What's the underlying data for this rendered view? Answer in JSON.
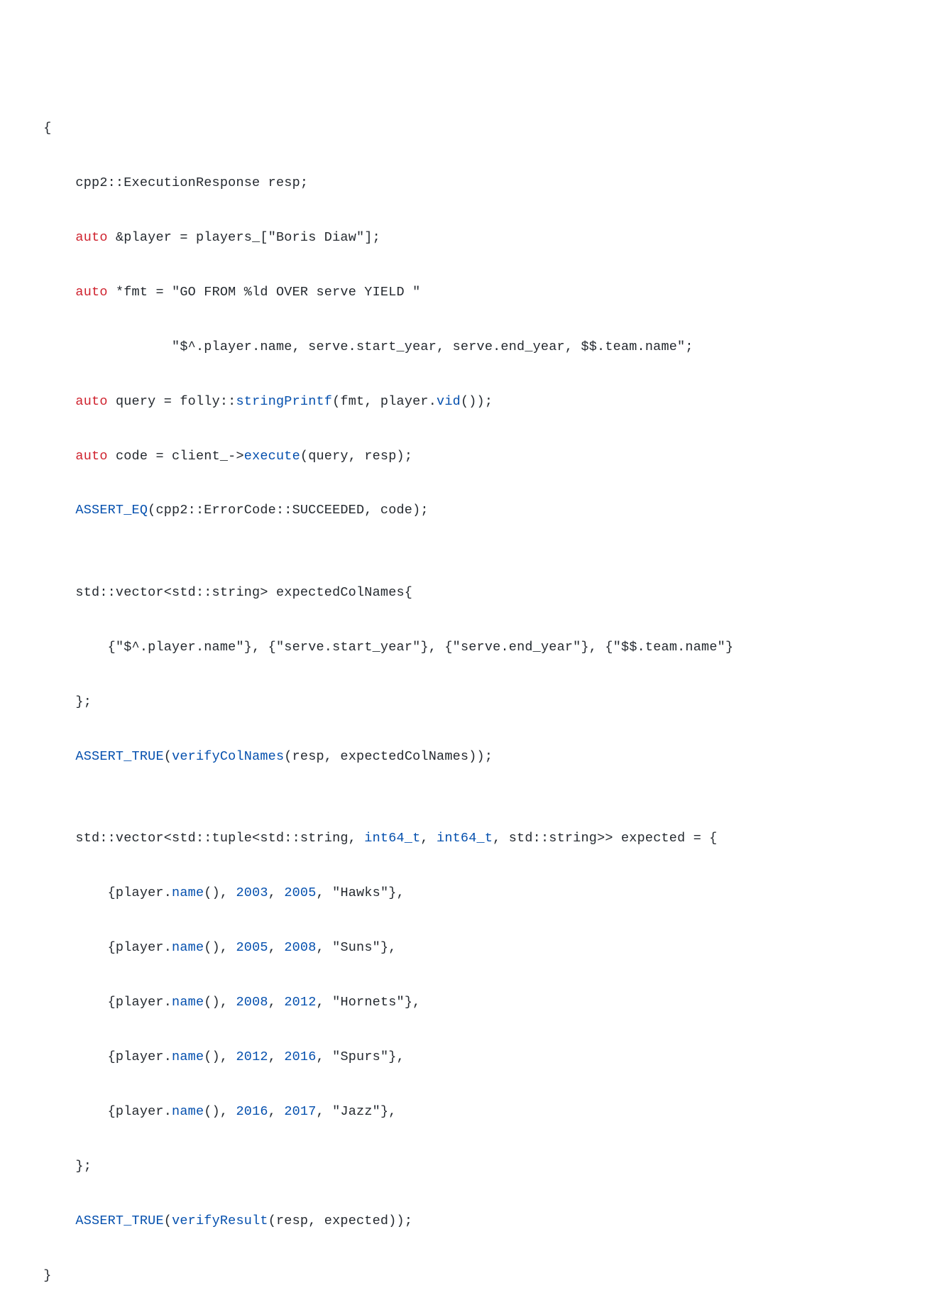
{
  "code": {
    "lines": [
      {
        "indent": 1,
        "tokens": [
          {
            "t": "{",
            "cls": "p"
          }
        ]
      },
      {
        "indent": 2,
        "tokens": [
          {
            "t": "cpp2::ExecutionResponse resp;",
            "cls": "p"
          }
        ]
      },
      {
        "indent": 2,
        "tokens": [
          {
            "t": "auto",
            "cls": "k"
          },
          {
            "t": " &player = players_[",
            "cls": "p"
          },
          {
            "t": "\"Boris Diaw\"",
            "cls": "s"
          },
          {
            "t": "];",
            "cls": "p"
          }
        ]
      },
      {
        "indent": 2,
        "tokens": [
          {
            "t": "auto",
            "cls": "k"
          },
          {
            "t": " *fmt = ",
            "cls": "p"
          },
          {
            "t": "\"GO FROM %ld OVER serve YIELD \"",
            "cls": "s"
          }
        ]
      },
      {
        "indent": 5,
        "tokens": [
          {
            "t": "\"$^.player.name, serve.start_year, serve.end_year, $$.team.name\"",
            "cls": "s"
          },
          {
            "t": ";",
            "cls": "p"
          }
        ]
      },
      {
        "indent": 2,
        "tokens": [
          {
            "t": "auto",
            "cls": "k"
          },
          {
            "t": " query = folly::",
            "cls": "p"
          },
          {
            "t": "stringPrintf",
            "cls": "fn"
          },
          {
            "t": "(fmt, player.",
            "cls": "p"
          },
          {
            "t": "vid",
            "cls": "fn"
          },
          {
            "t": "());",
            "cls": "p"
          }
        ]
      },
      {
        "indent": 2,
        "tokens": [
          {
            "t": "auto",
            "cls": "k"
          },
          {
            "t": " code = client_->",
            "cls": "p"
          },
          {
            "t": "execute",
            "cls": "fn"
          },
          {
            "t": "(query, resp);",
            "cls": "p"
          }
        ]
      },
      {
        "indent": 2,
        "tokens": [
          {
            "t": "ASSERT_EQ",
            "cls": "fn"
          },
          {
            "t": "(cpp2::ErrorCode::SUCCEEDED, code);",
            "cls": "p"
          }
        ]
      },
      {
        "indent": 0,
        "tokens": [
          {
            "t": "",
            "cls": "p"
          }
        ]
      },
      {
        "indent": 2,
        "tokens": [
          {
            "t": "std::vector<std::string> expectedColNames{",
            "cls": "p"
          }
        ]
      },
      {
        "indent": 3,
        "tokens": [
          {
            "t": "{",
            "cls": "p"
          },
          {
            "t": "\"$^.player.name\"",
            "cls": "s"
          },
          {
            "t": "}, {",
            "cls": "p"
          },
          {
            "t": "\"serve.start_year\"",
            "cls": "s"
          },
          {
            "t": "}, {",
            "cls": "p"
          },
          {
            "t": "\"serve.end_year\"",
            "cls": "s"
          },
          {
            "t": "}, {",
            "cls": "p"
          },
          {
            "t": "\"$$.team.name\"",
            "cls": "s"
          },
          {
            "t": "}",
            "cls": "p"
          }
        ]
      },
      {
        "indent": 2,
        "tokens": [
          {
            "t": "};",
            "cls": "p"
          }
        ]
      },
      {
        "indent": 2,
        "tokens": [
          {
            "t": "ASSERT_TRUE",
            "cls": "fn"
          },
          {
            "t": "(",
            "cls": "p"
          },
          {
            "t": "verifyColNames",
            "cls": "fn"
          },
          {
            "t": "(resp, expectedColNames));",
            "cls": "p"
          }
        ]
      },
      {
        "indent": 0,
        "tokens": [
          {
            "t": "",
            "cls": "p"
          }
        ]
      },
      {
        "indent": 2,
        "tokens": [
          {
            "t": "std::vector<std::tuple<std::string, ",
            "cls": "p"
          },
          {
            "t": "int64_t",
            "cls": "fn"
          },
          {
            "t": ", ",
            "cls": "p"
          },
          {
            "t": "int64_t",
            "cls": "fn"
          },
          {
            "t": ", std::string>> expected = {",
            "cls": "p"
          }
        ]
      },
      {
        "indent": 3,
        "tokens": [
          {
            "t": "{player.",
            "cls": "p"
          },
          {
            "t": "name",
            "cls": "fn"
          },
          {
            "t": "(), ",
            "cls": "p"
          },
          {
            "t": "2003",
            "cls": "n"
          },
          {
            "t": ", ",
            "cls": "p"
          },
          {
            "t": "2005",
            "cls": "n"
          },
          {
            "t": ", ",
            "cls": "p"
          },
          {
            "t": "\"Hawks\"",
            "cls": "s"
          },
          {
            "t": "},",
            "cls": "p"
          }
        ]
      },
      {
        "indent": 3,
        "tokens": [
          {
            "t": "{player.",
            "cls": "p"
          },
          {
            "t": "name",
            "cls": "fn"
          },
          {
            "t": "(), ",
            "cls": "p"
          },
          {
            "t": "2005",
            "cls": "n"
          },
          {
            "t": ", ",
            "cls": "p"
          },
          {
            "t": "2008",
            "cls": "n"
          },
          {
            "t": ", ",
            "cls": "p"
          },
          {
            "t": "\"Suns\"",
            "cls": "s"
          },
          {
            "t": "},",
            "cls": "p"
          }
        ]
      },
      {
        "indent": 3,
        "tokens": [
          {
            "t": "{player.",
            "cls": "p"
          },
          {
            "t": "name",
            "cls": "fn"
          },
          {
            "t": "(), ",
            "cls": "p"
          },
          {
            "t": "2008",
            "cls": "n"
          },
          {
            "t": ", ",
            "cls": "p"
          },
          {
            "t": "2012",
            "cls": "n"
          },
          {
            "t": ", ",
            "cls": "p"
          },
          {
            "t": "\"Hornets\"",
            "cls": "s"
          },
          {
            "t": "},",
            "cls": "p"
          }
        ]
      },
      {
        "indent": 3,
        "tokens": [
          {
            "t": "{player.",
            "cls": "p"
          },
          {
            "t": "name",
            "cls": "fn"
          },
          {
            "t": "(), ",
            "cls": "p"
          },
          {
            "t": "2012",
            "cls": "n"
          },
          {
            "t": ", ",
            "cls": "p"
          },
          {
            "t": "2016",
            "cls": "n"
          },
          {
            "t": ", ",
            "cls": "p"
          },
          {
            "t": "\"Spurs\"",
            "cls": "s"
          },
          {
            "t": "},",
            "cls": "p"
          }
        ]
      },
      {
        "indent": 3,
        "tokens": [
          {
            "t": "{player.",
            "cls": "p"
          },
          {
            "t": "name",
            "cls": "fn"
          },
          {
            "t": "(), ",
            "cls": "p"
          },
          {
            "t": "2016",
            "cls": "n"
          },
          {
            "t": ", ",
            "cls": "p"
          },
          {
            "t": "2017",
            "cls": "n"
          },
          {
            "t": ", ",
            "cls": "p"
          },
          {
            "t": "\"Jazz\"",
            "cls": "s"
          },
          {
            "t": "},",
            "cls": "p"
          }
        ]
      },
      {
        "indent": 2,
        "tokens": [
          {
            "t": "};",
            "cls": "p"
          }
        ]
      },
      {
        "indent": 2,
        "tokens": [
          {
            "t": "ASSERT_TRUE",
            "cls": "fn"
          },
          {
            "t": "(",
            "cls": "p"
          },
          {
            "t": "verifyResult",
            "cls": "fn"
          },
          {
            "t": "(resp, expected));",
            "cls": "p"
          }
        ]
      },
      {
        "indent": 1,
        "tokens": [
          {
            "t": "}",
            "cls": "p"
          }
        ]
      }
    ]
  },
  "indent_unit": "    "
}
